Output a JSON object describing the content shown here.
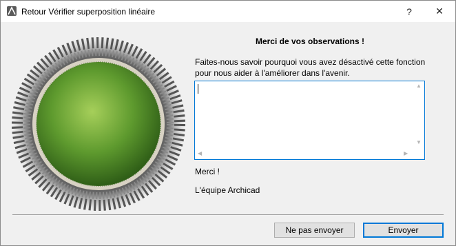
{
  "window": {
    "title": "Retour Vérifier superposition linéaire",
    "help_label": "?",
    "close_label": "✕"
  },
  "dialog": {
    "heading": "Merci de vos observations !",
    "description": "Faites-nous savoir pourquoi vous avez désactivé cette fonction pour nous aider à l'améliorer dans l'avenir.",
    "feedback_value": "",
    "thanks": "Merci !",
    "signature": "L'équipe Archicad"
  },
  "buttons": {
    "no_send": "Ne pas envoyer",
    "send": "Envoyer"
  },
  "colors": {
    "accent": "#0078d7",
    "grass": "#5e9a2e"
  },
  "icons": {
    "app": "archicad-icon",
    "help": "help-icon",
    "close": "close-icon"
  }
}
